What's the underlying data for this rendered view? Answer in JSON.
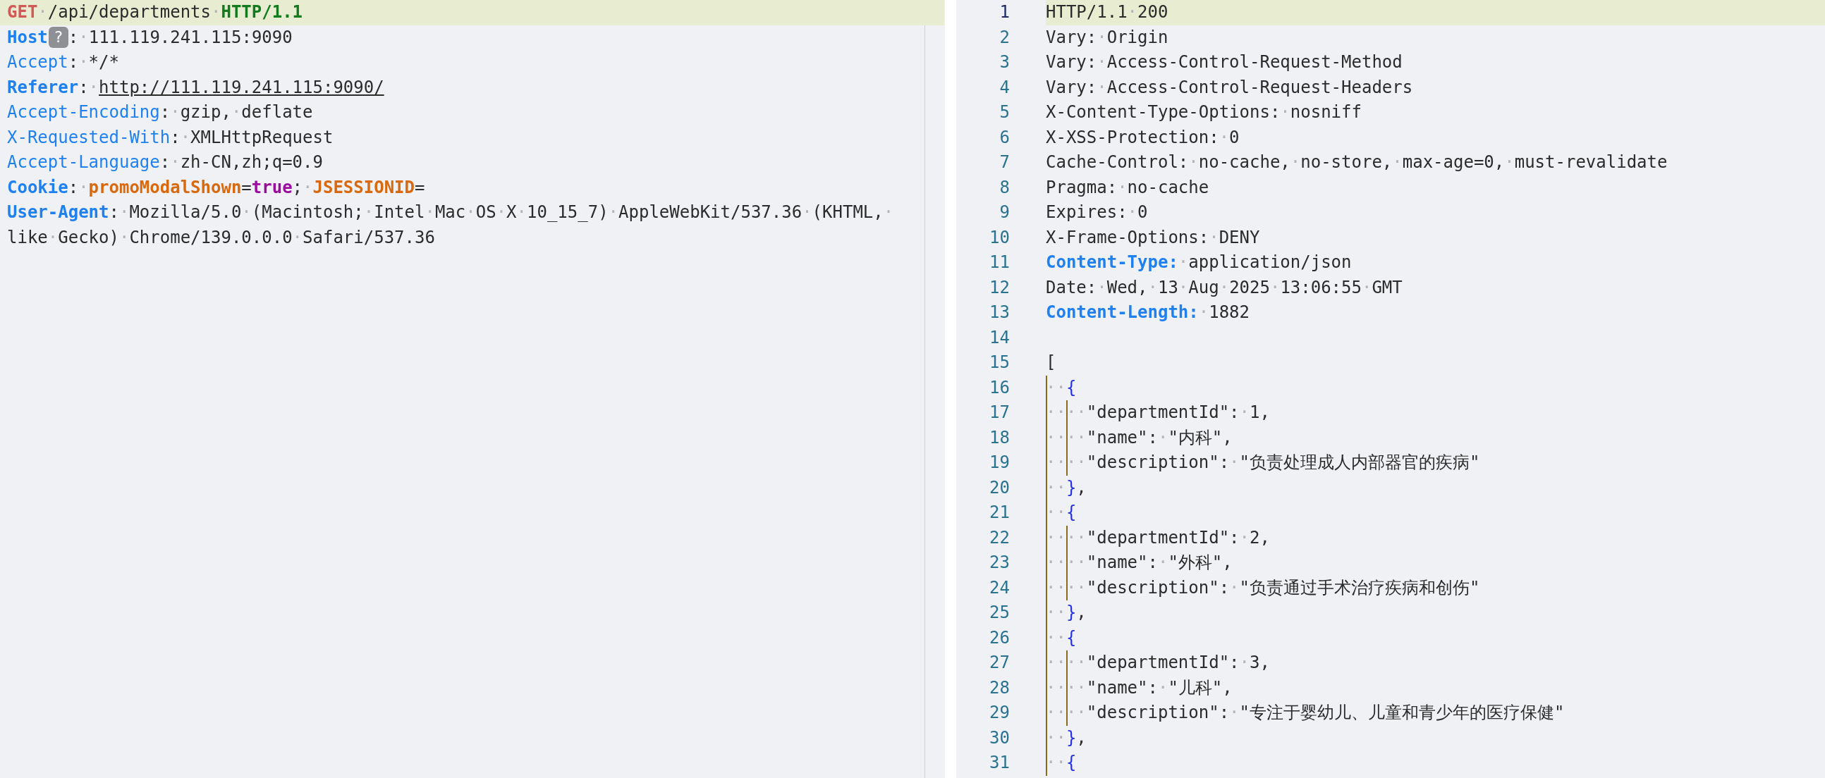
{
  "request": {
    "lines": [
      {
        "current": true,
        "tokens": [
          {
            "kind": "method",
            "text": "GET"
          },
          {
            "kind": "plain",
            "text": "·/api/departments·"
          },
          {
            "kind": "version",
            "text": "HTTP/1.1"
          }
        ]
      },
      {
        "current": false,
        "tokens": [
          {
            "kind": "key-bold",
            "text": "Host"
          },
          {
            "kind": "badge",
            "text": "?"
          },
          {
            "kind": "plain",
            "text": ":·111.119.241.115:9090"
          }
        ]
      },
      {
        "current": false,
        "tokens": [
          {
            "kind": "key",
            "text": "Accept"
          },
          {
            "kind": "plain",
            "text": ":·*/*"
          }
        ]
      },
      {
        "current": false,
        "tokens": [
          {
            "kind": "key-bold",
            "text": "Referer"
          },
          {
            "kind": "plain",
            "text": ":·"
          },
          {
            "kind": "link",
            "text": "http://111.119.241.115:9090/"
          }
        ]
      },
      {
        "current": false,
        "tokens": [
          {
            "kind": "key",
            "text": "Accept-Encoding"
          },
          {
            "kind": "plain",
            "text": ":·gzip,·deflate"
          }
        ]
      },
      {
        "current": false,
        "tokens": [
          {
            "kind": "key",
            "text": "X-Requested-With"
          },
          {
            "kind": "plain",
            "text": ":·XMLHttpRequest"
          }
        ]
      },
      {
        "current": false,
        "tokens": [
          {
            "kind": "key",
            "text": "Accept-Language"
          },
          {
            "kind": "plain",
            "text": ":·zh-CN,zh;q=0.9"
          }
        ]
      },
      {
        "current": false,
        "tokens": [
          {
            "kind": "key-bold",
            "text": "Cookie"
          },
          {
            "kind": "plain",
            "text": ":·"
          },
          {
            "kind": "cookie",
            "text": "promoModalShown"
          },
          {
            "kind": "plain",
            "text": "="
          },
          {
            "kind": "bool",
            "text": "true"
          },
          {
            "kind": "plain",
            "text": ";·"
          },
          {
            "kind": "cookie",
            "text": "JSESSIONID"
          },
          {
            "kind": "plain",
            "text": "="
          }
        ]
      },
      {
        "current": false,
        "tokens": [
          {
            "kind": "key-bold",
            "text": "User-Agent"
          },
          {
            "kind": "plain",
            "text": ":·Mozilla/5.0·(Macintosh;·Intel·Mac·OS·X·10_15_7)·AppleWebKit/537.36·(KHTML,·"
          }
        ]
      },
      {
        "current": false,
        "tokens": [
          {
            "kind": "plain",
            "text": "like·Gecko)·Chrome/139.0.0.0·Safari/537.36"
          }
        ]
      }
    ]
  },
  "response": {
    "lines": [
      {
        "number": "1",
        "current": true,
        "tokens": [
          {
            "kind": "plain",
            "text": "HTTP/1.1·200"
          }
        ]
      },
      {
        "number": "2",
        "current": false,
        "tokens": [
          {
            "kind": "plain",
            "text": "Vary:·Origin"
          }
        ]
      },
      {
        "number": "3",
        "current": false,
        "tokens": [
          {
            "kind": "plain",
            "text": "Vary:·Access-Control-Request-Method"
          }
        ]
      },
      {
        "number": "4",
        "current": false,
        "tokens": [
          {
            "kind": "plain",
            "text": "Vary:·Access-Control-Request-Headers"
          }
        ]
      },
      {
        "number": "5",
        "current": false,
        "tokens": [
          {
            "kind": "plain",
            "text": "X-Content-Type-Options:·nosniff"
          }
        ]
      },
      {
        "number": "6",
        "current": false,
        "tokens": [
          {
            "kind": "plain",
            "text": "X-XSS-Protection:·0"
          }
        ]
      },
      {
        "number": "7",
        "current": false,
        "tokens": [
          {
            "kind": "plain",
            "text": "Cache-Control:·no-cache,·no-store,·max-age=0,·must-revalidate"
          }
        ]
      },
      {
        "number": "8",
        "current": false,
        "tokens": [
          {
            "kind": "plain",
            "text": "Pragma:·no-cache"
          }
        ]
      },
      {
        "number": "9",
        "current": false,
        "tokens": [
          {
            "kind": "plain",
            "text": "Expires:·0"
          }
        ]
      },
      {
        "number": "10",
        "current": false,
        "tokens": [
          {
            "kind": "plain",
            "text": "X-Frame-Options:·DENY"
          }
        ]
      },
      {
        "number": "11",
        "current": false,
        "tokens": [
          {
            "kind": "key-bold",
            "text": "Content-Type:"
          },
          {
            "kind": "plain",
            "text": "·application/json"
          }
        ]
      },
      {
        "number": "12",
        "current": false,
        "tokens": [
          {
            "kind": "plain",
            "text": "Date:·Wed,·13·Aug·2025·13:06:55·GMT"
          }
        ]
      },
      {
        "number": "13",
        "current": false,
        "tokens": [
          {
            "kind": "key-bold",
            "text": "Content-Length:"
          },
          {
            "kind": "plain",
            "text": "·1882"
          }
        ]
      },
      {
        "number": "14",
        "current": false
      },
      {
        "number": "15",
        "current": false,
        "tokens": [
          {
            "kind": "plain",
            "text": "["
          }
        ]
      },
      {
        "number": "16",
        "current": false,
        "tokens": [
          {
            "kind": "guide",
            "text": "··"
          },
          {
            "kind": "brace",
            "text": "{"
          }
        ]
      },
      {
        "number": "17",
        "current": false,
        "tokens": [
          {
            "kind": "guide",
            "text": "··"
          },
          {
            "kind": "guide",
            "text": "··"
          },
          {
            "kind": "plain",
            "text": "\"departmentId\":·1,"
          }
        ]
      },
      {
        "number": "18",
        "current": false,
        "tokens": [
          {
            "kind": "guide",
            "text": "··"
          },
          {
            "kind": "guide",
            "text": "··"
          },
          {
            "kind": "plain",
            "text": "\"name\":·\"内科\","
          }
        ]
      },
      {
        "number": "19",
        "current": false,
        "tokens": [
          {
            "kind": "guide",
            "text": "··"
          },
          {
            "kind": "guide",
            "text": "··"
          },
          {
            "kind": "plain",
            "text": "\"description\":·\"负责处理成人内部器官的疾病\""
          }
        ]
      },
      {
        "number": "20",
        "current": false,
        "tokens": [
          {
            "kind": "guide",
            "text": "··"
          },
          {
            "kind": "brace",
            "text": "}"
          },
          {
            "kind": "plain",
            "text": ","
          }
        ]
      },
      {
        "number": "21",
        "current": false,
        "tokens": [
          {
            "kind": "guide",
            "text": "··"
          },
          {
            "kind": "brace",
            "text": "{"
          }
        ]
      },
      {
        "number": "22",
        "current": false,
        "tokens": [
          {
            "kind": "guide",
            "text": "··"
          },
          {
            "kind": "guide",
            "text": "··"
          },
          {
            "kind": "plain",
            "text": "\"departmentId\":·2,"
          }
        ]
      },
      {
        "number": "23",
        "current": false,
        "tokens": [
          {
            "kind": "guide",
            "text": "··"
          },
          {
            "kind": "guide",
            "text": "··"
          },
          {
            "kind": "plain",
            "text": "\"name\":·\"外科\","
          }
        ]
      },
      {
        "number": "24",
        "current": false,
        "tokens": [
          {
            "kind": "guide",
            "text": "··"
          },
          {
            "kind": "guide",
            "text": "··"
          },
          {
            "kind": "plain",
            "text": "\"description\":·\"负责通过手术治疗疾病和创伤\""
          }
        ]
      },
      {
        "number": "25",
        "current": false,
        "tokens": [
          {
            "kind": "guide",
            "text": "··"
          },
          {
            "kind": "brace",
            "text": "}"
          },
          {
            "kind": "plain",
            "text": ","
          }
        ]
      },
      {
        "number": "26",
        "current": false,
        "tokens": [
          {
            "kind": "guide",
            "text": "··"
          },
          {
            "kind": "brace",
            "text": "{"
          }
        ]
      },
      {
        "number": "27",
        "current": false,
        "tokens": [
          {
            "kind": "guide",
            "text": "··"
          },
          {
            "kind": "guide",
            "text": "··"
          },
          {
            "kind": "plain",
            "text": "\"departmentId\":·3,"
          }
        ]
      },
      {
        "number": "28",
        "current": false,
        "tokens": [
          {
            "kind": "guide",
            "text": "··"
          },
          {
            "kind": "guide",
            "text": "··"
          },
          {
            "kind": "plain",
            "text": "\"name\":·\"儿科\","
          }
        ]
      },
      {
        "number": "29",
        "current": false,
        "tokens": [
          {
            "kind": "guide",
            "text": "··"
          },
          {
            "kind": "guide",
            "text": "··"
          },
          {
            "kind": "plain",
            "text": "\"description\":·\"专注于婴幼儿、儿童和青少年的医疗保健\""
          }
        ]
      },
      {
        "number": "30",
        "current": false,
        "tokens": [
          {
            "kind": "guide",
            "text": "··"
          },
          {
            "kind": "brace",
            "text": "}"
          },
          {
            "kind": "plain",
            "text": ","
          }
        ]
      },
      {
        "number": "31",
        "current": false,
        "tokens": [
          {
            "kind": "guide",
            "text": "··"
          },
          {
            "kind": "brace",
            "text": "{"
          }
        ]
      }
    ]
  }
}
